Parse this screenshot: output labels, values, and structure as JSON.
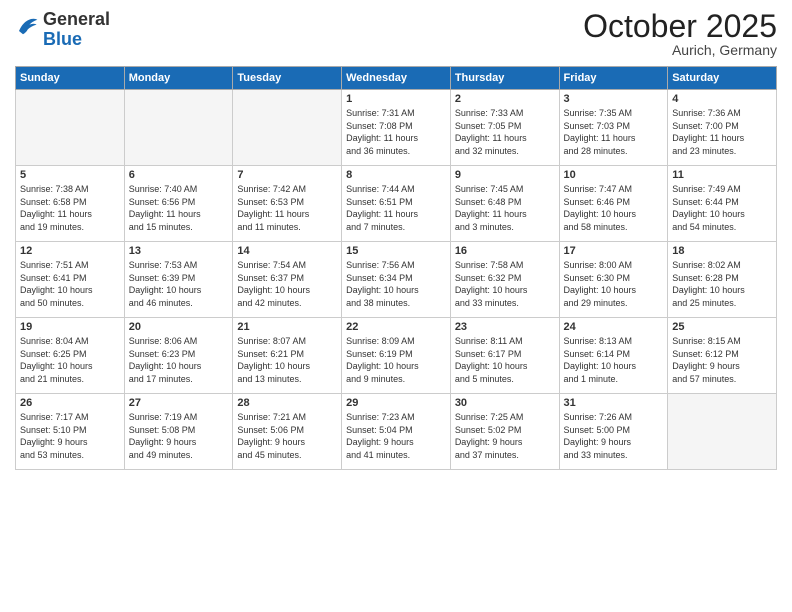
{
  "header": {
    "logo_general": "General",
    "logo_blue": "Blue",
    "title": "October 2025",
    "location": "Aurich, Germany"
  },
  "weekdays": [
    "Sunday",
    "Monday",
    "Tuesday",
    "Wednesday",
    "Thursday",
    "Friday",
    "Saturday"
  ],
  "weeks": [
    [
      {
        "day": "",
        "info": ""
      },
      {
        "day": "",
        "info": ""
      },
      {
        "day": "",
        "info": ""
      },
      {
        "day": "1",
        "info": "Sunrise: 7:31 AM\nSunset: 7:08 PM\nDaylight: 11 hours\nand 36 minutes."
      },
      {
        "day": "2",
        "info": "Sunrise: 7:33 AM\nSunset: 7:05 PM\nDaylight: 11 hours\nand 32 minutes."
      },
      {
        "day": "3",
        "info": "Sunrise: 7:35 AM\nSunset: 7:03 PM\nDaylight: 11 hours\nand 28 minutes."
      },
      {
        "day": "4",
        "info": "Sunrise: 7:36 AM\nSunset: 7:00 PM\nDaylight: 11 hours\nand 23 minutes."
      }
    ],
    [
      {
        "day": "5",
        "info": "Sunrise: 7:38 AM\nSunset: 6:58 PM\nDaylight: 11 hours\nand 19 minutes."
      },
      {
        "day": "6",
        "info": "Sunrise: 7:40 AM\nSunset: 6:56 PM\nDaylight: 11 hours\nand 15 minutes."
      },
      {
        "day": "7",
        "info": "Sunrise: 7:42 AM\nSunset: 6:53 PM\nDaylight: 11 hours\nand 11 minutes."
      },
      {
        "day": "8",
        "info": "Sunrise: 7:44 AM\nSunset: 6:51 PM\nDaylight: 11 hours\nand 7 minutes."
      },
      {
        "day": "9",
        "info": "Sunrise: 7:45 AM\nSunset: 6:48 PM\nDaylight: 11 hours\nand 3 minutes."
      },
      {
        "day": "10",
        "info": "Sunrise: 7:47 AM\nSunset: 6:46 PM\nDaylight: 10 hours\nand 58 minutes."
      },
      {
        "day": "11",
        "info": "Sunrise: 7:49 AM\nSunset: 6:44 PM\nDaylight: 10 hours\nand 54 minutes."
      }
    ],
    [
      {
        "day": "12",
        "info": "Sunrise: 7:51 AM\nSunset: 6:41 PM\nDaylight: 10 hours\nand 50 minutes."
      },
      {
        "day": "13",
        "info": "Sunrise: 7:53 AM\nSunset: 6:39 PM\nDaylight: 10 hours\nand 46 minutes."
      },
      {
        "day": "14",
        "info": "Sunrise: 7:54 AM\nSunset: 6:37 PM\nDaylight: 10 hours\nand 42 minutes."
      },
      {
        "day": "15",
        "info": "Sunrise: 7:56 AM\nSunset: 6:34 PM\nDaylight: 10 hours\nand 38 minutes."
      },
      {
        "day": "16",
        "info": "Sunrise: 7:58 AM\nSunset: 6:32 PM\nDaylight: 10 hours\nand 33 minutes."
      },
      {
        "day": "17",
        "info": "Sunrise: 8:00 AM\nSunset: 6:30 PM\nDaylight: 10 hours\nand 29 minutes."
      },
      {
        "day": "18",
        "info": "Sunrise: 8:02 AM\nSunset: 6:28 PM\nDaylight: 10 hours\nand 25 minutes."
      }
    ],
    [
      {
        "day": "19",
        "info": "Sunrise: 8:04 AM\nSunset: 6:25 PM\nDaylight: 10 hours\nand 21 minutes."
      },
      {
        "day": "20",
        "info": "Sunrise: 8:06 AM\nSunset: 6:23 PM\nDaylight: 10 hours\nand 17 minutes."
      },
      {
        "day": "21",
        "info": "Sunrise: 8:07 AM\nSunset: 6:21 PM\nDaylight: 10 hours\nand 13 minutes."
      },
      {
        "day": "22",
        "info": "Sunrise: 8:09 AM\nSunset: 6:19 PM\nDaylight: 10 hours\nand 9 minutes."
      },
      {
        "day": "23",
        "info": "Sunrise: 8:11 AM\nSunset: 6:17 PM\nDaylight: 10 hours\nand 5 minutes."
      },
      {
        "day": "24",
        "info": "Sunrise: 8:13 AM\nSunset: 6:14 PM\nDaylight: 10 hours\nand 1 minute."
      },
      {
        "day": "25",
        "info": "Sunrise: 8:15 AM\nSunset: 6:12 PM\nDaylight: 9 hours\nand 57 minutes."
      }
    ],
    [
      {
        "day": "26",
        "info": "Sunrise: 7:17 AM\nSunset: 5:10 PM\nDaylight: 9 hours\nand 53 minutes."
      },
      {
        "day": "27",
        "info": "Sunrise: 7:19 AM\nSunset: 5:08 PM\nDaylight: 9 hours\nand 49 minutes."
      },
      {
        "day": "28",
        "info": "Sunrise: 7:21 AM\nSunset: 5:06 PM\nDaylight: 9 hours\nand 45 minutes."
      },
      {
        "day": "29",
        "info": "Sunrise: 7:23 AM\nSunset: 5:04 PM\nDaylight: 9 hours\nand 41 minutes."
      },
      {
        "day": "30",
        "info": "Sunrise: 7:25 AM\nSunset: 5:02 PM\nDaylight: 9 hours\nand 37 minutes."
      },
      {
        "day": "31",
        "info": "Sunrise: 7:26 AM\nSunset: 5:00 PM\nDaylight: 9 hours\nand 33 minutes."
      },
      {
        "day": "",
        "info": ""
      }
    ]
  ]
}
